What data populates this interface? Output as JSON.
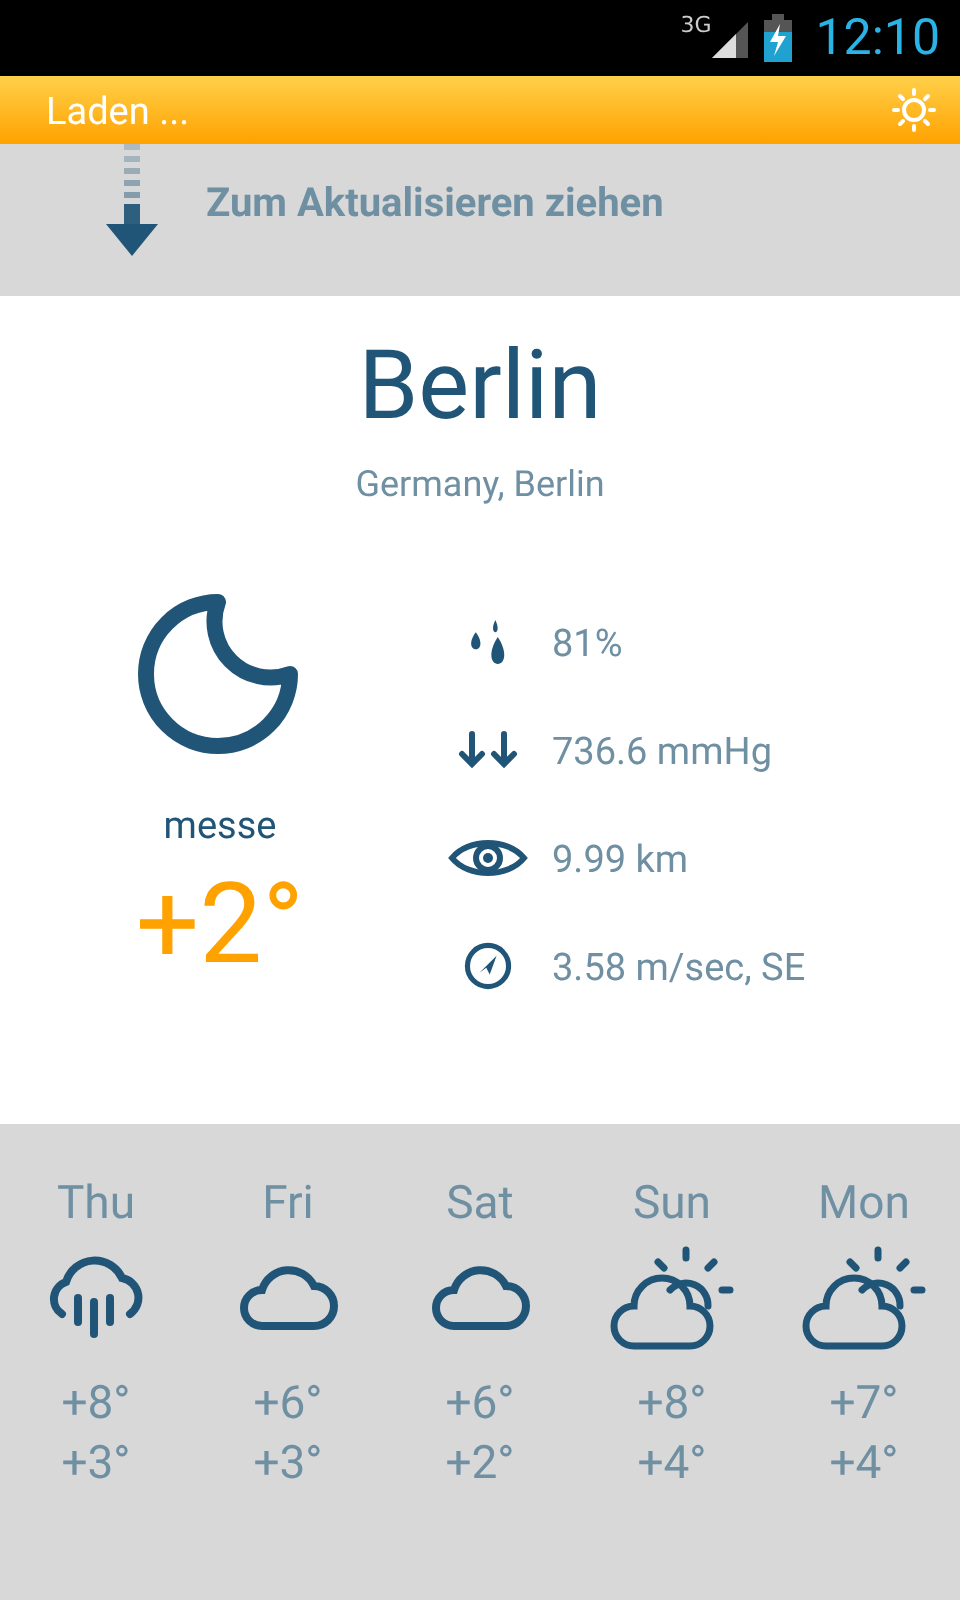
{
  "status_bar": {
    "network": "3G",
    "time": "12:10"
  },
  "action_bar": {
    "title": "Laden ..."
  },
  "pull_hint": {
    "text": "Zum Aktualisieren ziehen"
  },
  "city": {
    "name": "Berlin",
    "region": "Germany, Berlin"
  },
  "current": {
    "condition": "messe",
    "temperature": "+2°"
  },
  "details": [
    {
      "kind": "humidity",
      "value": "81%"
    },
    {
      "kind": "pressure",
      "value": "736.6 mmHg"
    },
    {
      "kind": "visibility",
      "value": "9.99 km"
    },
    {
      "kind": "wind",
      "value": "3.58 m/sec, SE"
    }
  ],
  "forecast": [
    {
      "day": "Thu",
      "kind": "rain",
      "high": "+8°",
      "low": "+3°"
    },
    {
      "day": "Fri",
      "kind": "cloud",
      "high": "+6°",
      "low": "+3°"
    },
    {
      "day": "Sat",
      "kind": "cloud",
      "high": "+6°",
      "low": "+2°"
    },
    {
      "day": "Sun",
      "kind": "partly",
      "high": "+8°",
      "low": "+4°"
    },
    {
      "day": "Mon",
      "kind": "partly",
      "high": "+7°",
      "low": "+4°"
    }
  ]
}
